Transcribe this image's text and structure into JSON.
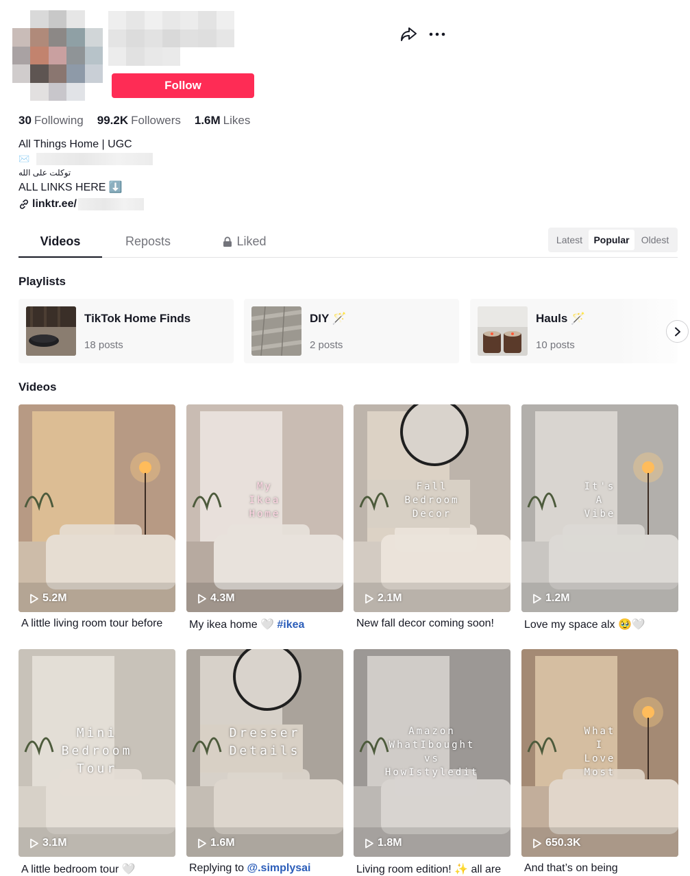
{
  "profile": {
    "follow_label": "Follow",
    "stats": {
      "following_value": "30",
      "following_label": "Following",
      "followers_value": "99.2K",
      "followers_label": "Followers",
      "likes_value": "1.6M",
      "likes_label": "Likes"
    },
    "bio": {
      "line1": "All Things Home | UGC",
      "email_icon": "✉️",
      "arabic": "توكلت على الله",
      "line4": "ALL LINKS HERE ⬇️",
      "link": "linktr.ee/"
    }
  },
  "icons": {
    "share": "share-icon",
    "more": "more-icon",
    "link": "link-icon",
    "lock": "lock-icon",
    "play": "play-icon",
    "next": "chevron-right-icon"
  },
  "tabs": {
    "videos": "Videos",
    "reposts": "Reposts",
    "liked": "Liked"
  },
  "sort": {
    "latest": "Latest",
    "popular": "Popular",
    "oldest": "Oldest"
  },
  "sections": {
    "playlists": "Playlists",
    "videos": "Videos"
  },
  "playlists": [
    {
      "name": "TikTok Home Finds",
      "count": "18 posts"
    },
    {
      "name": "DIY 🪄",
      "count": "2 posts"
    },
    {
      "name": "Hauls 🪄",
      "count": "10 posts"
    }
  ],
  "videos": [
    {
      "views": "5.2M",
      "overlay": "",
      "caption_pre": "A little living room tour before",
      "tag": ""
    },
    {
      "views": "4.3M",
      "overlay": "My\nIkea\nHome",
      "caption_pre": "My ikea home 🤍 ",
      "tag": "#ikea"
    },
    {
      "views": "2.1M",
      "overlay": "Fall\nBedroom\nDecor",
      "caption_pre": "New fall decor coming soon!",
      "tag": ""
    },
    {
      "views": "1.2M",
      "overlay": "It's\nA\nVibe",
      "caption_pre": "Love my space alx 🥹🤍",
      "tag": ""
    },
    {
      "views": "3.1M",
      "overlay": "Mini\nBedroom\nTour",
      "caption_pre": "A little bedroom tour 🤍",
      "tag": ""
    },
    {
      "views": "1.6M",
      "overlay": "Dresser\nDetails",
      "caption_pre": "Replying to ",
      "tag": "@.simplysai"
    },
    {
      "views": "1.8M",
      "overlay": "Amazon\nWhatIbought\nvs\nHowIstyledit",
      "caption_pre": "Living room edition! ✨ all are",
      "tag": ""
    },
    {
      "views": "650.3K",
      "overlay": "What\nI\nLove\nMost",
      "caption_pre": "And that’s on being",
      "tag": ""
    }
  ]
}
